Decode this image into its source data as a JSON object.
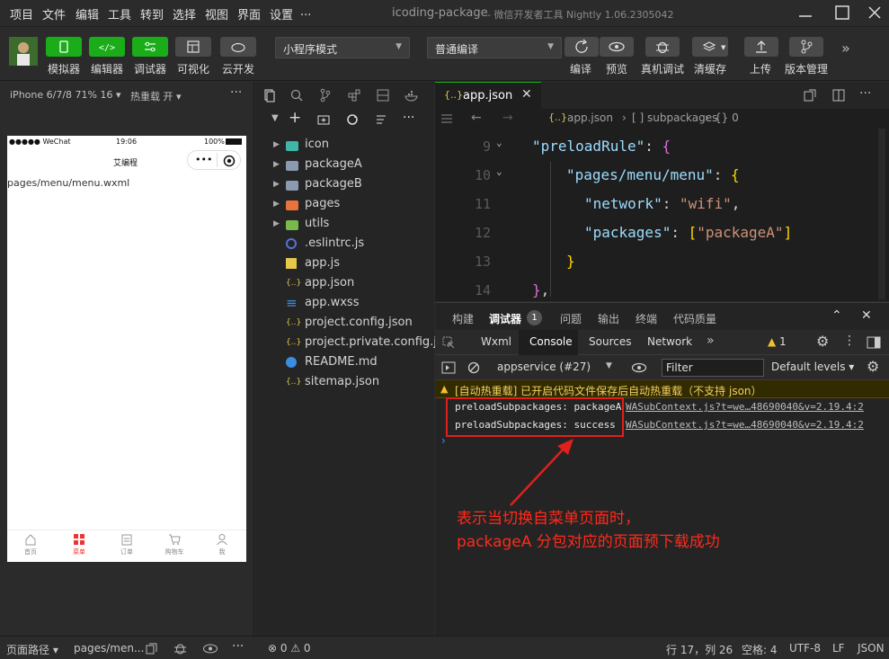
{
  "menubar": {
    "items": [
      "项目",
      "文件",
      "编辑",
      "工具",
      "转到",
      "选择",
      "视图",
      "界面",
      "设置",
      "..."
    ],
    "title": "icoding-package",
    "subtitle": "- 微信开发者工具 Nightly 1.06.2305042"
  },
  "toolbar": {
    "simulator": "模拟器",
    "editor": "编辑器",
    "debugger": "调试器",
    "visual": "可视化",
    "cloud": "云开发",
    "mode": "小程序模式",
    "compile_mode": "普通编译",
    "compile": "编译",
    "preview": "预览",
    "real_debug": "真机调试",
    "clear_cache": "清缓存",
    "upload": "上传",
    "version": "版本管理"
  },
  "simulator": {
    "device": "iPhone 6/7/8 71% 16 ▾",
    "hot_reload": "热重载 开 ▾",
    "status_carrier": "●●●●● WeChat",
    "status_time": "19:06",
    "status_battery": "100%",
    "nav_title": "艾编程",
    "page_path": "pages/menu/menu.wxml",
    "tabs": [
      "首页",
      "菜单",
      "订单",
      "购物车",
      "我"
    ]
  },
  "explorer": {
    "files": [
      {
        "name": "icon",
        "type": "folder-special",
        "expandable": true
      },
      {
        "name": "packageA",
        "type": "folder",
        "expandable": true
      },
      {
        "name": "packageB",
        "type": "folder",
        "expandable": true
      },
      {
        "name": "pages",
        "type": "folder-pages",
        "expandable": true
      },
      {
        "name": "utils",
        "type": "folder-utils",
        "expandable": true
      },
      {
        "name": ".eslintrc.js",
        "type": "eslint",
        "expandable": false
      },
      {
        "name": "app.js",
        "type": "js",
        "expandable": false
      },
      {
        "name": "app.json",
        "type": "json",
        "expandable": false
      },
      {
        "name": "app.wxss",
        "type": "wxss",
        "expandable": false
      },
      {
        "name": "project.config.json",
        "type": "json",
        "expandable": false
      },
      {
        "name": "project.private.config.js...",
        "type": "json",
        "expandable": false
      },
      {
        "name": "README.md",
        "type": "info",
        "expandable": false
      },
      {
        "name": "sitemap.json",
        "type": "json",
        "expandable": false
      }
    ]
  },
  "editor": {
    "tab_label": "app.json",
    "breadcrumb_file": "app.json",
    "breadcrumb_1": "[ ] subpackages",
    "breadcrumb_2": "{} 0",
    "lines": [
      {
        "num": "9",
        "text": "\"preloadRule\": {"
      },
      {
        "num": "10",
        "text": "\"pages/menu/menu\": {"
      },
      {
        "num": "11",
        "text": "\"network\": \"wifi\","
      },
      {
        "num": "12",
        "text": "\"packages\": [\"packageA\"]"
      },
      {
        "num": "13",
        "text": "}"
      },
      {
        "num": "14",
        "text": "},"
      }
    ]
  },
  "debug": {
    "panel_tabs": [
      "构建",
      "调试器",
      "问题",
      "输出",
      "终端",
      "代码质量"
    ],
    "badge": "1",
    "dev_tabs": [
      "Wxml",
      "Console",
      "Sources",
      "Network"
    ],
    "warn_count": "1",
    "context": "appservice (#27)",
    "filter_placeholder": "Filter",
    "levels": "Default levels ▾",
    "warn_message": "[自动热重载] 已开启代码文件保存后自动热重载（不支持 json）",
    "logs": [
      {
        "message": "preloadSubpackages: packageA",
        "source": "WASubContext.js?t=we…48690040&v=2.19.4:2"
      },
      {
        "message": "preloadSubpackages: success",
        "source": "WASubContext.js?t=we…48690040&v=2.19.4:2"
      }
    ],
    "annotation_line1": "表示当切换自菜单页面时，",
    "annotation_line2": "packageA 分包对应的页面预下载成功"
  },
  "statusbar": {
    "page_path_label": "页面路径 ▾",
    "page_path": "pages/men...",
    "errors": "⊗ 0 ⚠ 0",
    "position": "行 17，列 26",
    "spaces": "空格: 4",
    "encoding": "UTF-8",
    "eol": "LF",
    "language": "JSON"
  },
  "colors": {
    "accent": "#1aad19",
    "annotation": "#ff2a1a",
    "json_key": "#9cdcfe",
    "json_string": "#ce9178"
  }
}
